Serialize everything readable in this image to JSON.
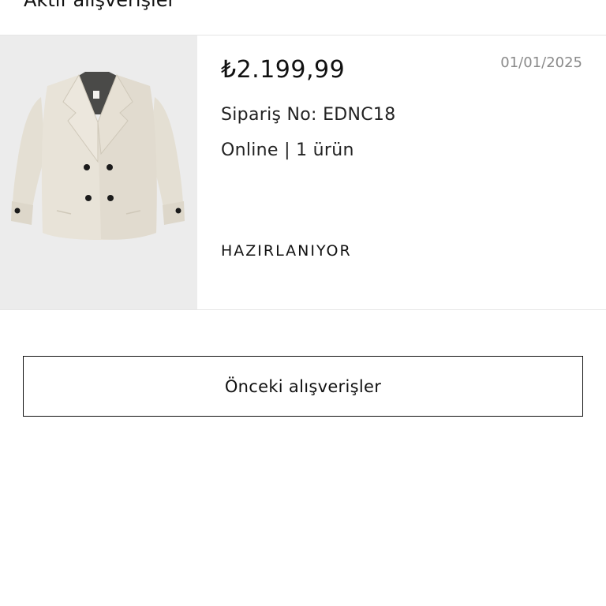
{
  "header": {
    "title": "Aktif alışverişler"
  },
  "order": {
    "price": "₺2.199,99",
    "date": "01/01/2025",
    "order_number_label": "Sipariş No:",
    "order_number": "EDNC18",
    "channel": "Online",
    "separator": "|",
    "item_count": "1 ürün",
    "status": "HAZIRLANIYOR",
    "thumbnail_icon": "coat-product-image",
    "thumbnail_bg": "#ececec"
  },
  "actions": {
    "previous_orders_label": "Önceki alışverişler"
  }
}
